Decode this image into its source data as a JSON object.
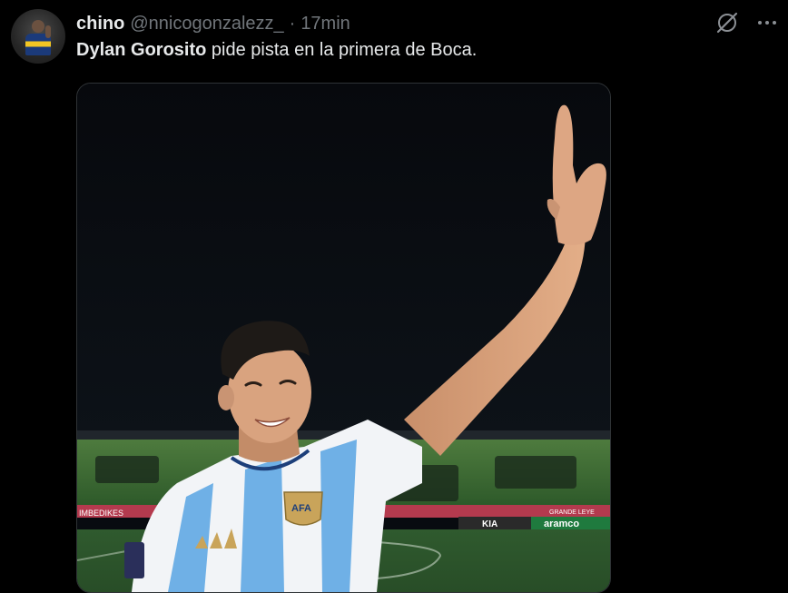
{
  "tweet": {
    "author_name": "chino",
    "author_handle": "@nnicogonzalezz_",
    "separator": "·",
    "time": "17min",
    "text_bold": "Dylan Gorosito",
    "text_rest": " pide pista en la primera de Boca."
  },
  "media": {
    "ad_boards": [
      "IMBEDIKES",
      "KIA",
      "aramco",
      "GRANDE LEYE"
    ],
    "crest_text": "AFA"
  },
  "icons": {
    "grok": "grok-icon",
    "more": "more-icon"
  },
  "colors": {
    "background": "#000000",
    "text": "#e7e9ea",
    "muted": "#71767b",
    "border": "#2f3336"
  }
}
